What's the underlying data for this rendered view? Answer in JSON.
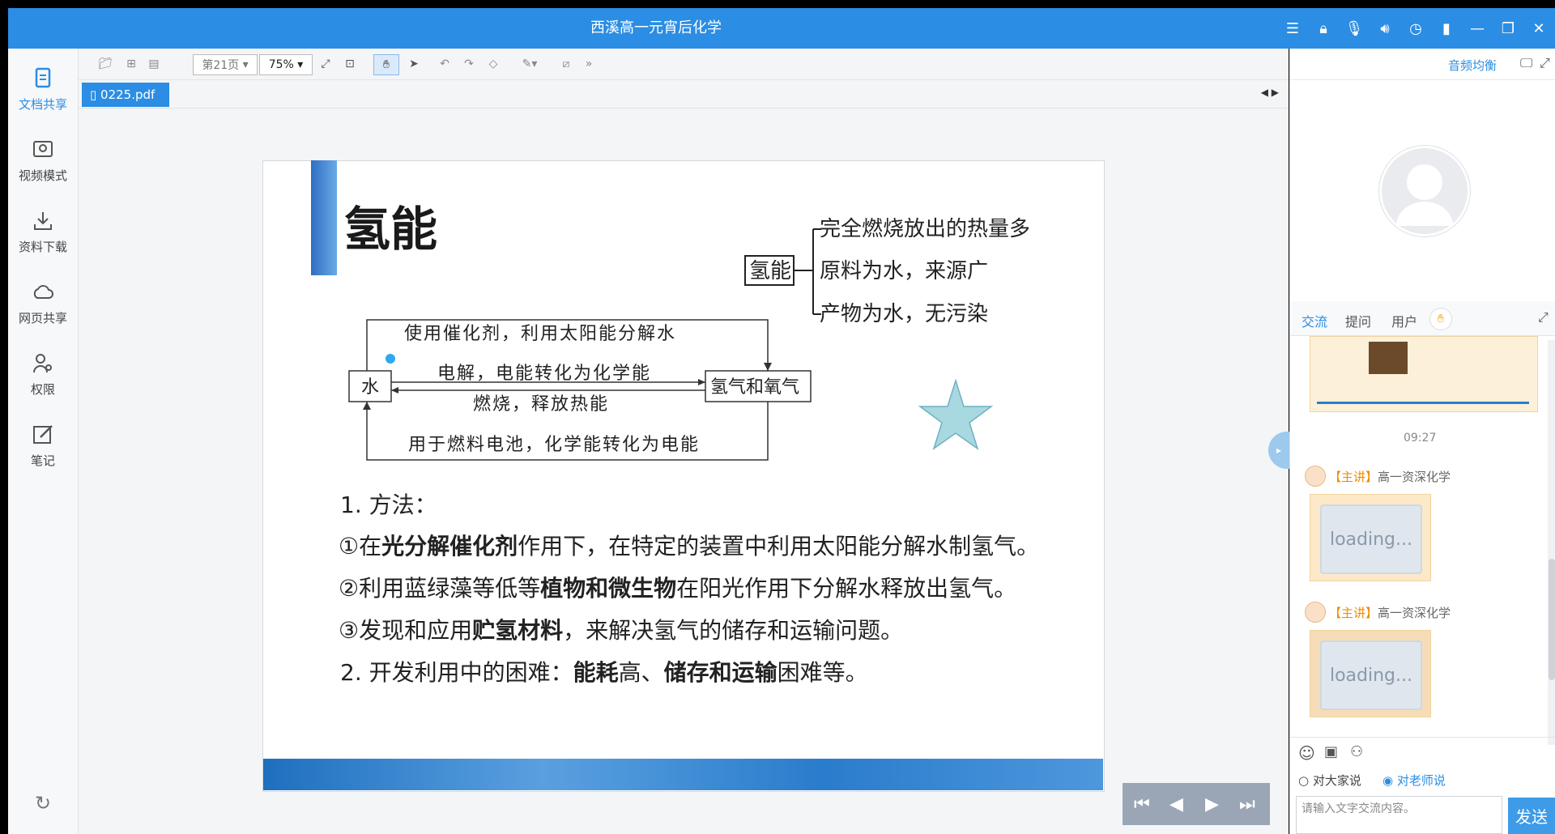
{
  "window": {
    "title": "西溪高一元宵后化学"
  },
  "left_nav": {
    "items": [
      {
        "label": "文档共享"
      },
      {
        "label": "视频模式"
      },
      {
        "label": "资料下载"
      },
      {
        "label": "网页共享"
      },
      {
        "label": "权限"
      },
      {
        "label": "笔记"
      }
    ]
  },
  "toolbar": {
    "page_select": "第21页",
    "zoom": "75%"
  },
  "document_tab": {
    "filename": "0225.pdf"
  },
  "slide": {
    "title": "氢能",
    "bracket_box": "氢能",
    "bracket_items": [
      "完全燃烧放出的热量多",
      "原料为水，来源广",
      "产物为水，无污染"
    ],
    "cycle": {
      "left_box": "水",
      "right_box": "氢气和氧气",
      "top_label": "使用催化剂，利用太阳能分解水",
      "mid_top_label": "电解，电能转化为化学能",
      "mid_bottom_label": "燃烧，释放热能",
      "bottom_label": "用于燃料电池，化学能转化为电能"
    },
    "method_heading": "1. 方法：",
    "lines": [
      {
        "pre": "①在",
        "bold": "光分解催化剂",
        "post": "作用下，在特定的装置中利用太阳能分解水制氢气。"
      },
      {
        "pre": "②利用蓝绿藻等低等",
        "bold": "植物和微生物",
        "post": "在阳光作用下分解水释放出氢气。"
      },
      {
        "pre": "③发现和应用",
        "bold": "贮氢材料",
        "post": "，来解决氢气的储存和运输问题。"
      }
    ],
    "difficulty": {
      "pre": "2. 开发利用中的困难：",
      "b1": "能耗",
      "mid": "高、",
      "b2": "储存和运输",
      "post": "困难等。"
    }
  },
  "right_panel": {
    "balance_label": "音频均衡",
    "tabs": [
      "交流",
      "提问",
      "用户"
    ],
    "chat_time": "09:27",
    "messages": [
      {
        "tag": "【主讲】",
        "sender": "高一资深化学",
        "content": "loading..."
      },
      {
        "tag": "【主讲】",
        "sender": "高一资深化学",
        "content": "loading..."
      }
    ],
    "radio": {
      "opt_all": "对大家说",
      "opt_teacher": "对老师说"
    },
    "input_placeholder": "请输入文字交流内容。",
    "send_label": "发送"
  },
  "colors": {
    "accent": "#2b8de3",
    "tag_orange": "#f08c00"
  }
}
